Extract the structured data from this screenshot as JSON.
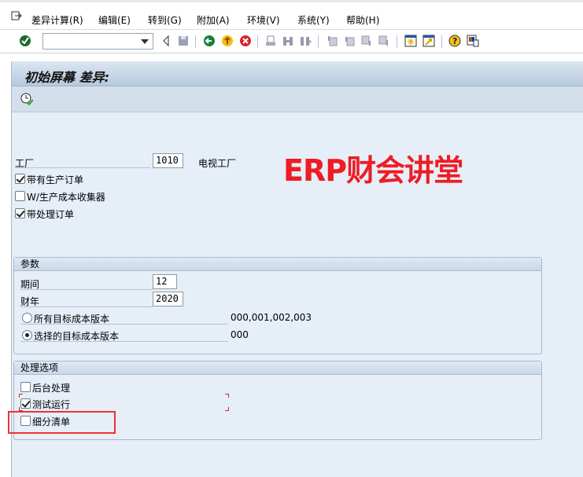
{
  "menu": {
    "items": [
      "差异计算(R)",
      "编辑(E)",
      "转到(G)",
      "附加(A)",
      "环境(V)",
      "系统(Y)",
      "帮助(H)"
    ]
  },
  "toolbar": {
    "command_field": ""
  },
  "screen": {
    "title": "初始屏幕 差异:"
  },
  "form": {
    "plant_label": "工厂",
    "plant_value": "1010",
    "plant_desc": "电视工厂",
    "with_production_orders": "带有生产订单",
    "with_production_orders_checked": true,
    "with_cost_collectors": "W/生产成本收集器",
    "with_cost_collectors_checked": false,
    "with_process_orders": "带处理订单",
    "with_process_orders_checked": true
  },
  "params": {
    "title": "参数",
    "period_label": "期间",
    "period_value": "12",
    "year_label": "财年",
    "year_value": "2020",
    "all_versions_label": "所有目标成本版本",
    "all_versions_value": "000,001,002,003",
    "selected_versions_label": "选择的目标成本版本",
    "selected_versions_value": "000",
    "selected_radio": "selected"
  },
  "processing": {
    "title": "处理选项",
    "background_label": "后台处理",
    "background_checked": false,
    "test_run_label": "测试运行",
    "test_run_checked": true,
    "detail_list_label": "细分清单",
    "detail_list_checked": false
  },
  "watermark": "ERP财会讲堂",
  "colors": {
    "watermark": "#ee1c24",
    "highlight_box": "#ee3333"
  }
}
